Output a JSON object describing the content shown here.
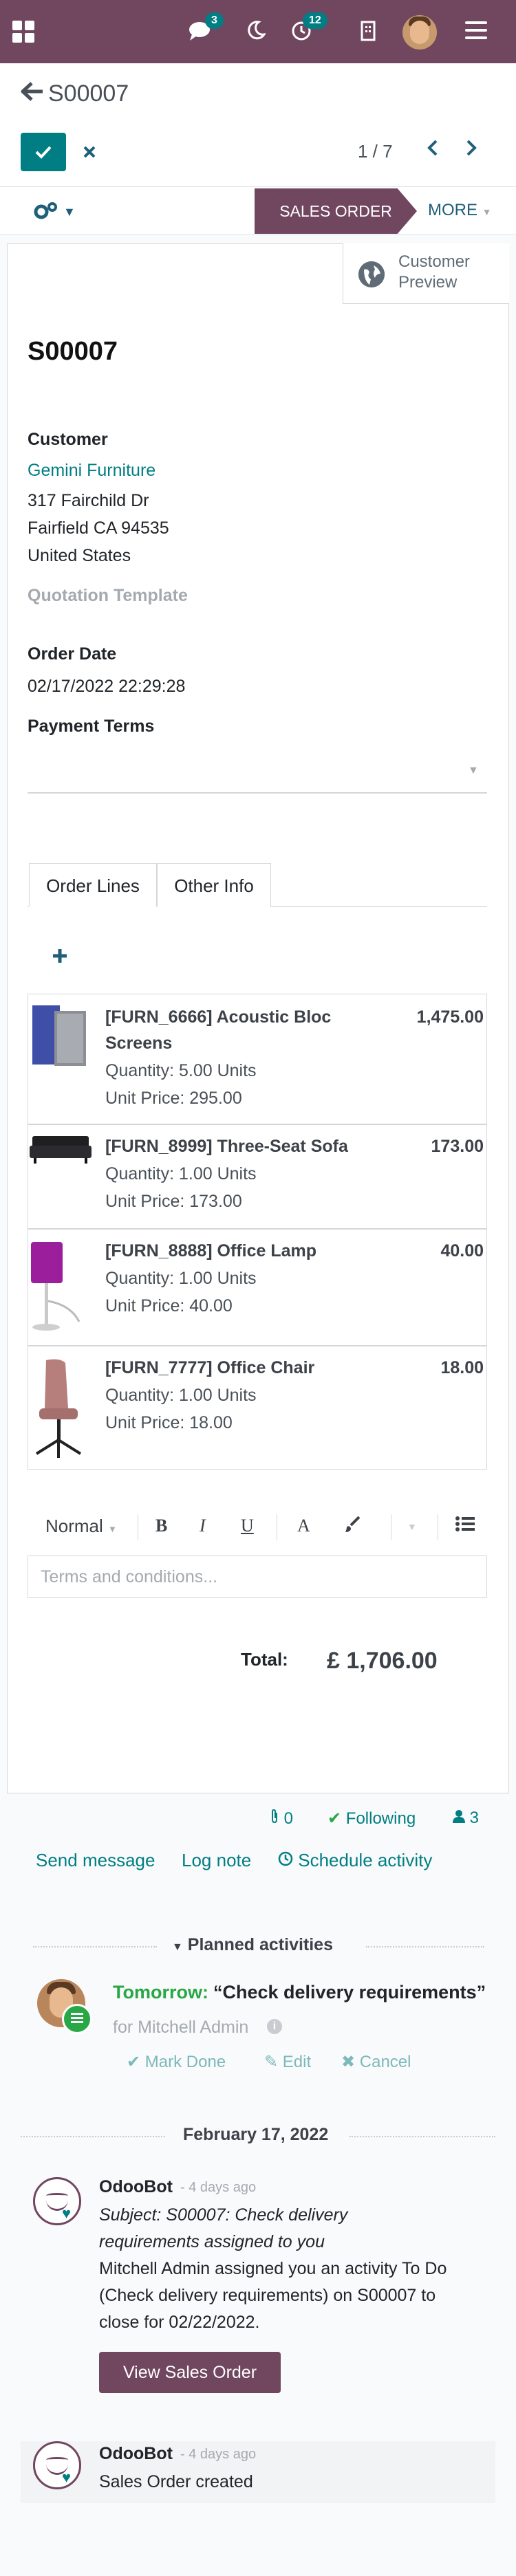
{
  "topbar": {
    "messages_badge": "3",
    "activities_badge": "12"
  },
  "control_panel": {
    "breadcrumb": "S00007",
    "pager": "1 / 7"
  },
  "statusbar": {
    "active_stage": "SALES ORDER",
    "more_label": "MORE"
  },
  "smart_button": {
    "label": "Customer Preview"
  },
  "order": {
    "name": "S00007",
    "customer_label": "Customer",
    "customer_name": "Gemini Furniture",
    "address_line1": "317 Fairchild Dr",
    "address_line2": "Fairfield CA 94535",
    "address_line3": "United States",
    "quotation_template_label": "Quotation Template",
    "order_date_label": "Order Date",
    "order_date": "02/17/2022 22:29:28",
    "payment_terms_label": "Payment Terms"
  },
  "tabs": [
    {
      "label": "Order Lines"
    },
    {
      "label": "Other Info"
    }
  ],
  "order_lines": [
    {
      "name": "[FURN_6666] Acoustic Bloc Screens",
      "quantity": "Quantity: 5.00 Units",
      "unit_price": "Unit Price: 295.00",
      "amount": "1,475.00",
      "icon": "acoustic-screen"
    },
    {
      "name": "[FURN_8999] Three-Seat Sofa",
      "quantity": "Quantity: 1.00 Units",
      "unit_price": "Unit Price: 173.00",
      "amount": "173.00",
      "icon": "sofa"
    },
    {
      "name": "[FURN_8888] Office Lamp",
      "quantity": "Quantity: 1.00 Units",
      "unit_price": "Unit Price: 40.00",
      "amount": "40.00",
      "icon": "lamp"
    },
    {
      "name": "[FURN_7777] Office Chair",
      "quantity": "Quantity: 1.00 Units",
      "unit_price": "Unit Price: 18.00",
      "amount": "18.00",
      "icon": "chair"
    }
  ],
  "editor": {
    "style_label": "Normal",
    "bold": "B",
    "italic": "I",
    "underline": "U",
    "font_color": "A",
    "terms_placeholder": "Terms and conditions..."
  },
  "totals": {
    "label": "Total:",
    "value": "£ 1,706.00"
  },
  "chatter": {
    "attachments": "0",
    "following_label": "Following",
    "followers": "3",
    "send_message": "Send message",
    "log_note": "Log note",
    "schedule_activity": "Schedule activity",
    "planned_activities_title": "Planned activities",
    "activity": {
      "when": "Tomorrow:",
      "summary": "“Check delivery requirements”",
      "for": "for Mitchell Admin",
      "mark_done": "Mark Done",
      "edit": "Edit",
      "cancel": "Cancel"
    },
    "date_separator": "February 17, 2022",
    "messages": [
      {
        "author": "OdooBot",
        "date": "- 4 days ago",
        "subject_line1": "Subject: S00007: Check delivery",
        "subject_line2": "requirements assigned to you",
        "body_line1": "Mitchell Admin assigned you an activity To Do",
        "body_line2": "(Check delivery requirements) on S00007 to",
        "body_line3": "close for 02/22/2022.",
        "button": "View Sales Order"
      },
      {
        "author": "OdooBot",
        "date": "- 4 days ago",
        "body_line1": "Sales Order created"
      }
    ]
  },
  "colors": {
    "brand": "#71465f",
    "accent": "#017e84",
    "success": "#28a745"
  }
}
